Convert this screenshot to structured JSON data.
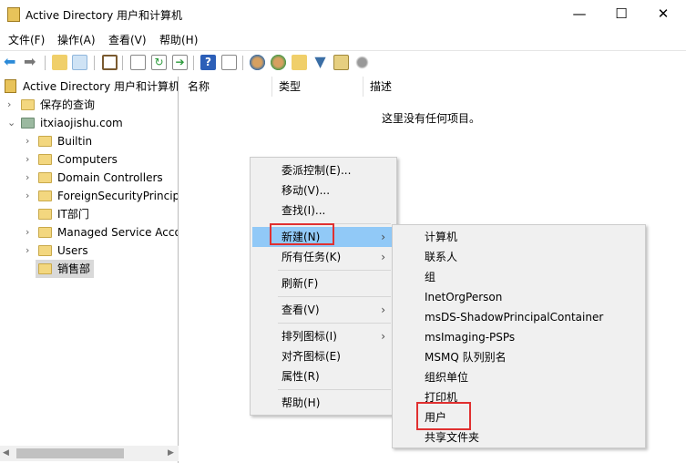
{
  "window": {
    "title": "Active Directory 用户和计算机",
    "minimize": "—",
    "maximize": "☐",
    "close": "✕"
  },
  "menubar": [
    "文件(F)",
    "操作(A)",
    "查看(V)",
    "帮助(H)"
  ],
  "toolbar": [
    "back-icon",
    "forward-icon",
    "up-folder-icon",
    "show-tree-icon",
    "clipboard-icon",
    "properties-icon",
    "refresh-icon",
    "export-icon",
    "help-icon",
    "action-pane-icon",
    "new-user-icon",
    "new-group-icon",
    "new-ou-icon",
    "filter-icon",
    "find-icon",
    "delegate-icon"
  ],
  "tree": {
    "root": "Active Directory 用户和计算机",
    "saved": "保存的查询",
    "domain": "itxiaojishu.com",
    "children": [
      "Builtin",
      "Computers",
      "Domain Controllers",
      "ForeignSecurityPrincipals",
      "IT部门",
      "Managed Service Accounts",
      "Users",
      "销售部"
    ]
  },
  "list": {
    "columns": [
      "名称",
      "类型",
      "描述"
    ],
    "empty": "这里没有任何项目。"
  },
  "context_menu": {
    "items": [
      "委派控制(E)...",
      "移动(V)...",
      "查找(I)...",
      "新建(N)",
      "所有任务(K)",
      "刷新(F)",
      "查看(V)",
      "排列图标(I)",
      "对齐图标(E)",
      "属性(R)",
      "帮助(H)"
    ],
    "submenu_arrow": "›"
  },
  "submenu": {
    "items": [
      "计算机",
      "联系人",
      "组",
      "InetOrgPerson",
      "msDS-ShadowPrincipalContainer",
      "msImaging-PSPs",
      "MSMQ 队列别名",
      "组织单位",
      "打印机",
      "用户",
      "共享文件夹"
    ]
  },
  "colors": {
    "highlight": "#91c9f7",
    "annotation": "#e03030"
  }
}
